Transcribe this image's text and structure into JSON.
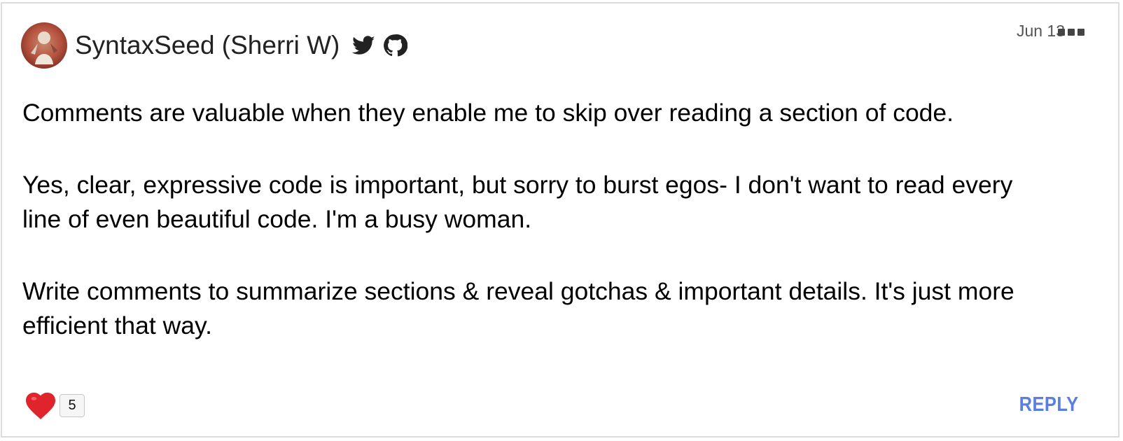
{
  "comment": {
    "author": "SyntaxSeed (Sherri W)",
    "date": "Jun 13",
    "paragraphs": [
      "Comments are valuable when they enable me to skip over reading a section of code.",
      "Yes, clear, expressive code is important, but sorry to burst egos- I don't want to read every line of even beautiful code. I'm a busy woman.",
      "Write comments to summarize sections & reveal gotchas & important details. It's just more efficient that way."
    ],
    "reaction_count": "5",
    "reply_label": "REPLY"
  },
  "icons": {
    "social": [
      "twitter-icon",
      "github-icon"
    ],
    "menu": "more-options-icon",
    "reaction": "heart-icon"
  },
  "colors": {
    "accent": "#5b7fe0",
    "heart": "#e0242c",
    "border": "#dcdcdc"
  }
}
